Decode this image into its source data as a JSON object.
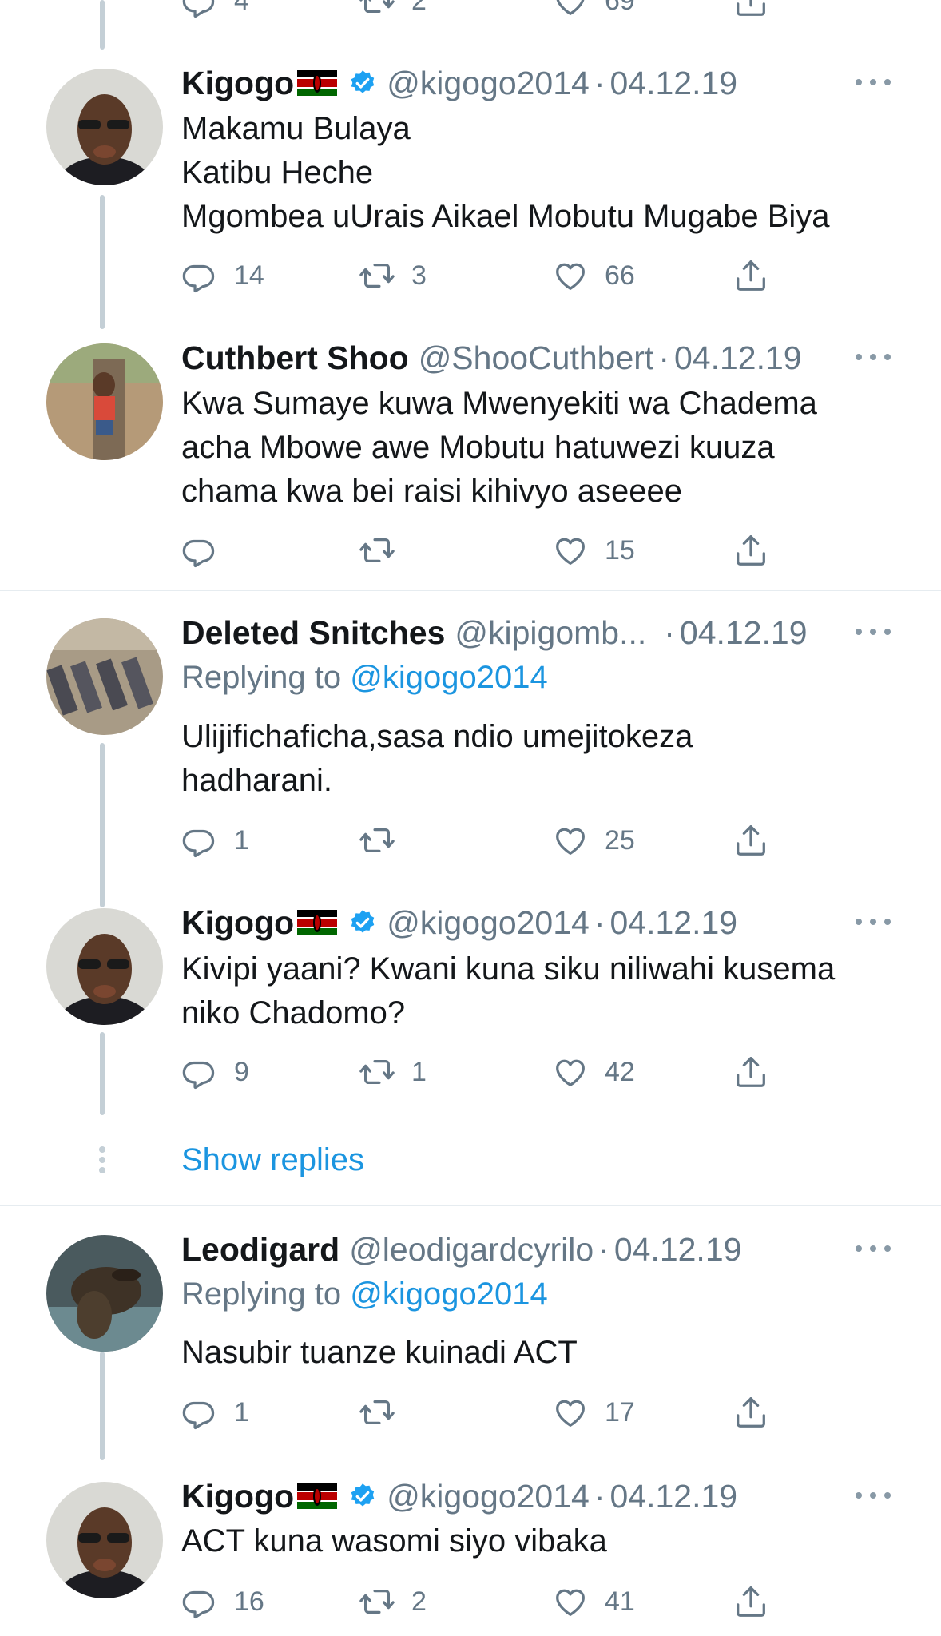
{
  "tweets": [
    {
      "name": "Kigogo",
      "verified": true,
      "handle": "@kigogo2014",
      "date": "04.12.19",
      "lines": [
        "Makamu Bulaya",
        "Katibu Heche",
        "Mgombea uUrais Aikael Mobutu Mugabe Biya"
      ],
      "reply_count": "14",
      "retweet_count": "3",
      "like_count": "66"
    },
    {
      "name": "Cuthbert Shoo",
      "handle": "@ShooCuthbert",
      "date": "04.12.19",
      "lines": [
        "Kwa Sumaye kuwa Mwenyekiti wa Chadema",
        "acha Mbowe awe Mobutu hatuwezi kuuza",
        "chama kwa bei raisi kihivyo aseeee"
      ],
      "reply_count": "",
      "retweet_count": "",
      "like_count": "15"
    },
    {
      "name": "Deleted Snitches",
      "handle": "@kipigomb...",
      "date": "04.12.19",
      "replying_label": "Replying to",
      "replying_to": "@kigogo2014",
      "lines": [
        "Ulijifichaficha,sasa ndio umejitokeza",
        "hadharani."
      ],
      "reply_count": "1",
      "retweet_count": "",
      "like_count": "25"
    },
    {
      "name": "Kigogo",
      "verified": true,
      "handle": "@kigogo2014",
      "date": "04.12.19",
      "lines": [
        "Kivipi yaani? Kwani kuna siku niliwahi kusema",
        "niko Chadomo?"
      ],
      "reply_count": "9",
      "retweet_count": "1",
      "like_count": "42"
    },
    {
      "name": "Leodigard",
      "handle": "@leodigardcyrilo",
      "date": "04.12.19",
      "replying_label": "Replying to",
      "replying_to": "@kigogo2014",
      "lines": [
        "Nasubir tuanze kuinadi ACT"
      ],
      "reply_count": "1",
      "retweet_count": "",
      "like_count": "17"
    },
    {
      "name": "Kigogo",
      "verified": true,
      "handle": "@kigogo2014",
      "date": "04.12.19",
      "lines": [
        "ACT kuna wasomi siyo vibaka"
      ],
      "reply_count": "16",
      "retweet_count": "2",
      "like_count": "41"
    }
  ],
  "top_partial": {
    "reply_count": "4",
    "retweet_count": "2",
    "like_count": "69"
  },
  "show_replies_label": "Show replies",
  "colors": {
    "link": "#1b95e0",
    "secondary": "#657786",
    "thread_line": "#c4cfd6",
    "separator": "#e6ecf0",
    "verified": "#1da1f2"
  }
}
